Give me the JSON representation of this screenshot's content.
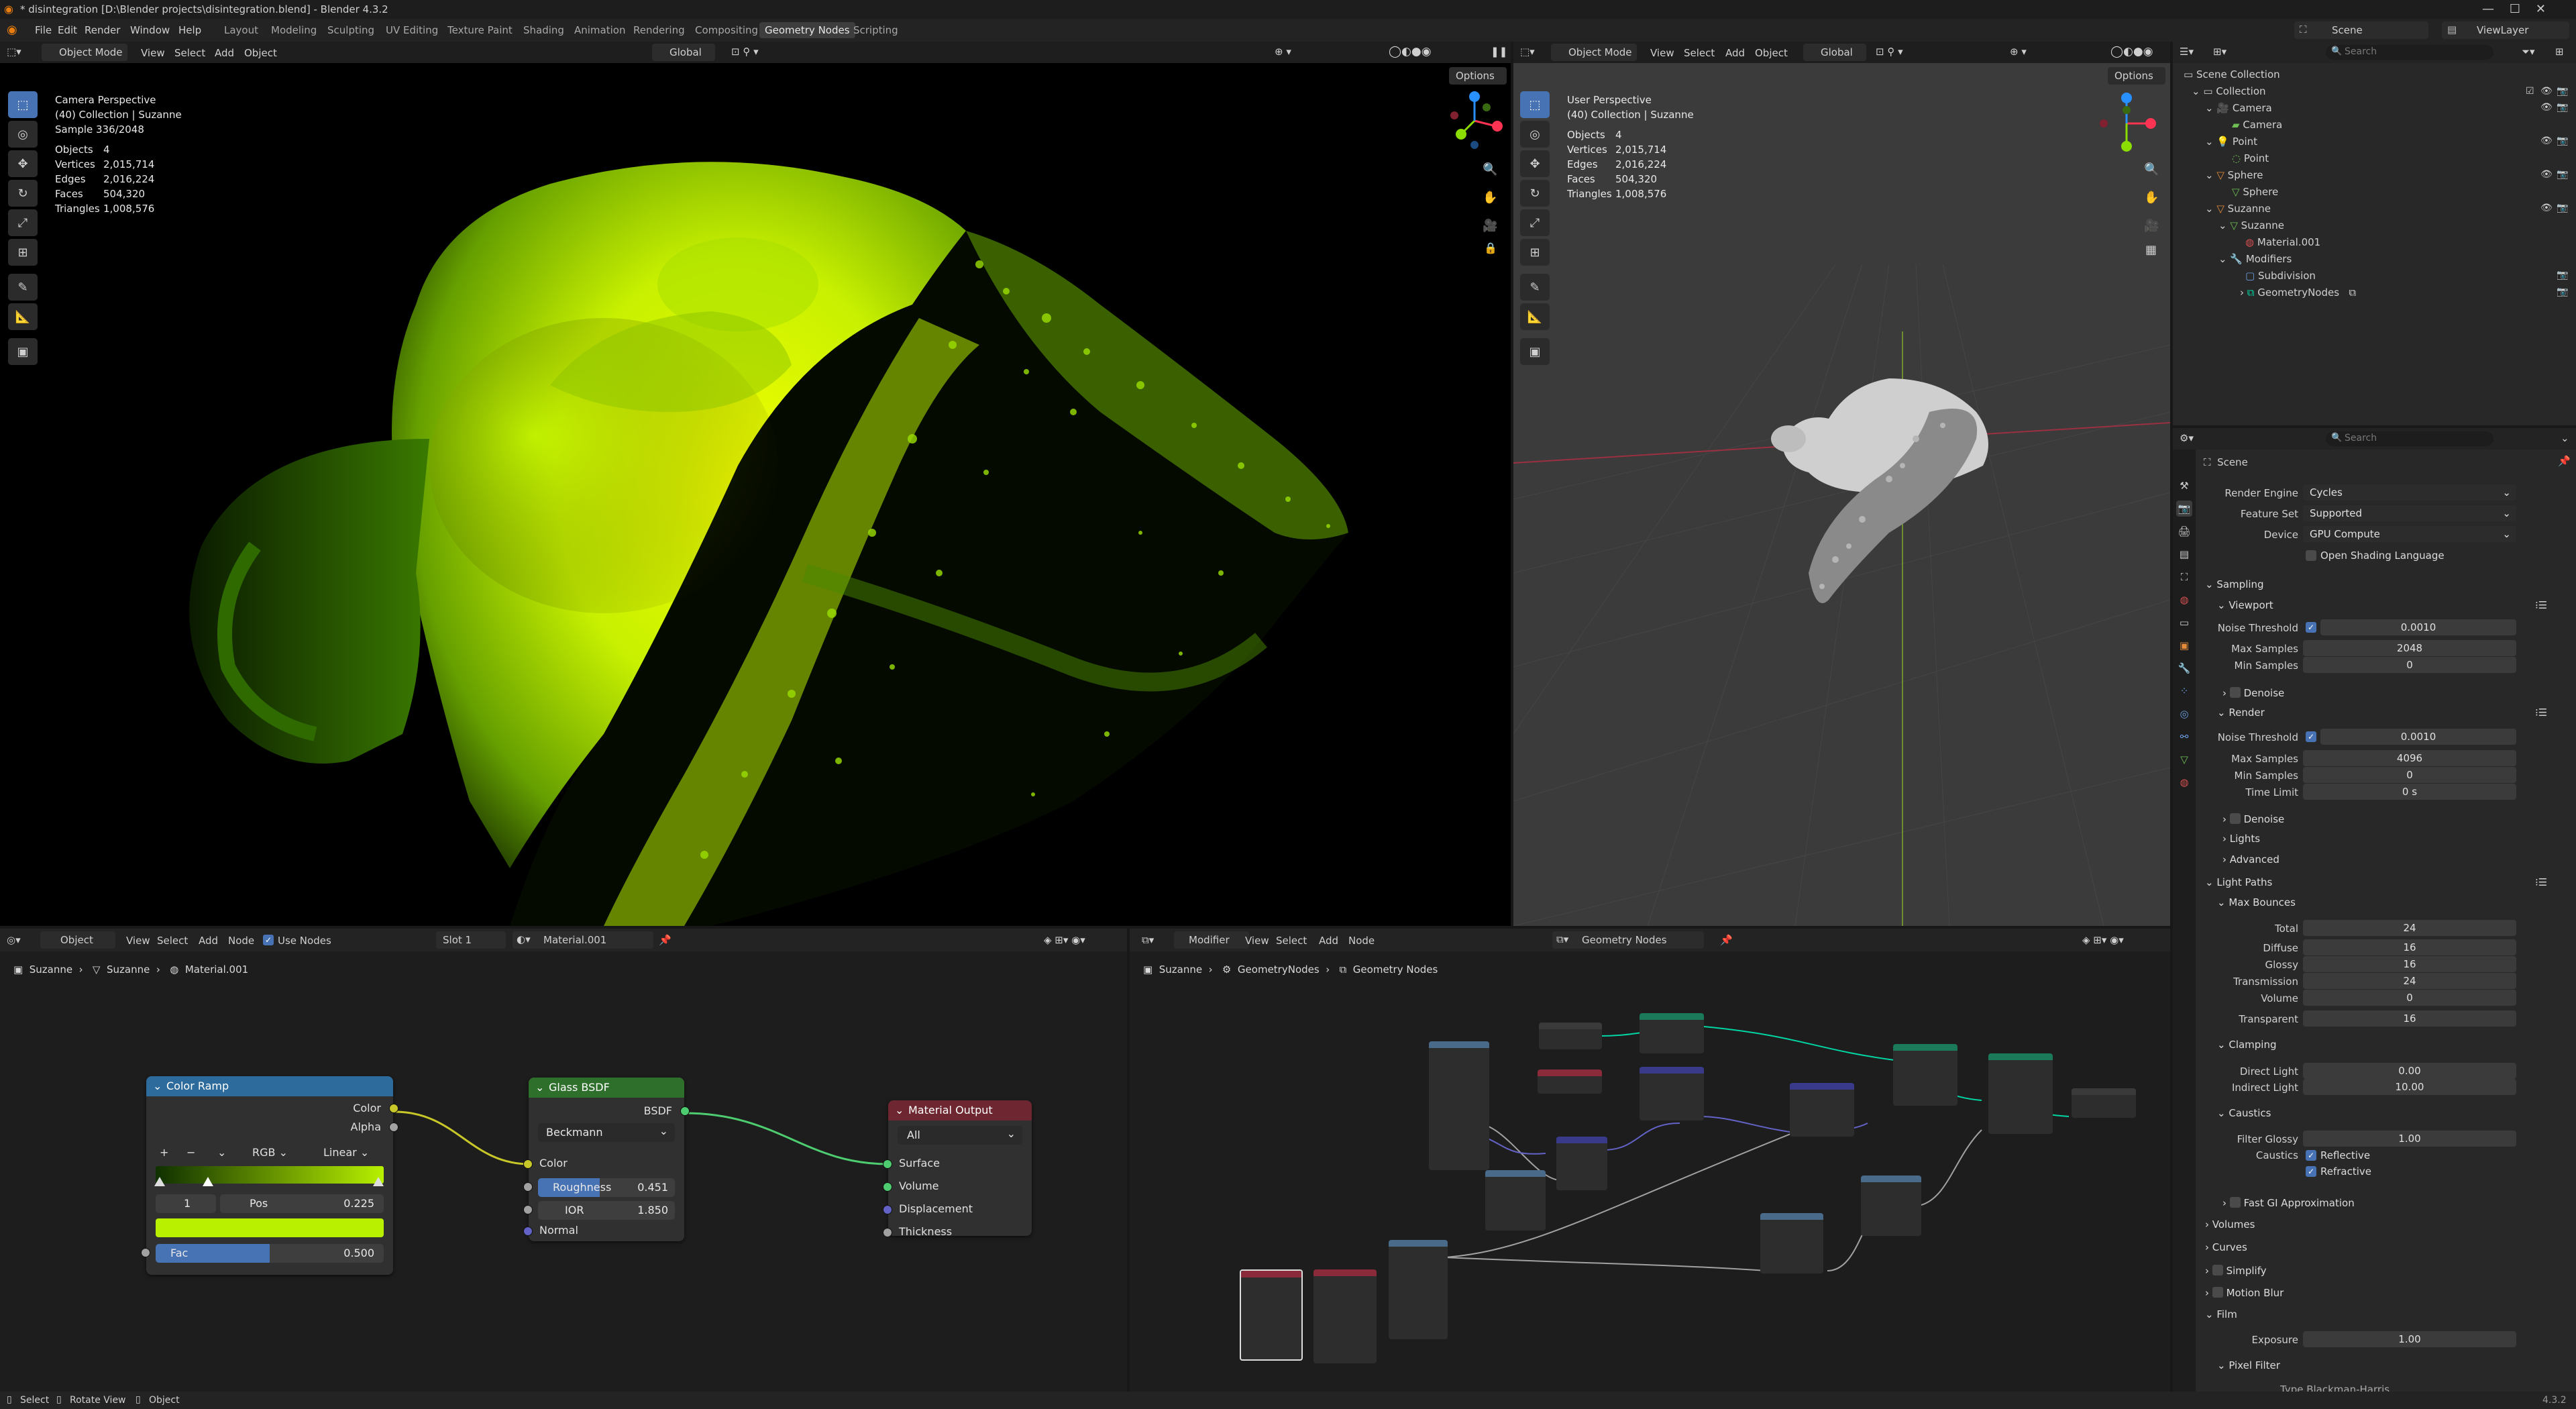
{
  "window": {
    "title": "* disintegration [D:\\Blender projects\\disintegration.blend] - Blender 4.3.2"
  },
  "menu": [
    "File",
    "Edit",
    "Render",
    "Window",
    "Help"
  ],
  "workspaces": [
    "Layout",
    "Modeling",
    "Sculpting",
    "UV Editing",
    "Texture Paint",
    "Shading",
    "Animation",
    "Rendering",
    "Compositing",
    "Geometry Nodes",
    "Scripting"
  ],
  "active_workspace": "Geometry Nodes",
  "topbar": {
    "scene": "Scene",
    "view_layer": "ViewLayer"
  },
  "vp_left": {
    "header": {
      "mode": "Object Mode",
      "view": "View",
      "select": "Select",
      "add": "Add",
      "object": "Object",
      "orientation": "Global",
      "options": "Options"
    },
    "overlay": {
      "title": "Camera Perspective",
      "collection": "(40) Collection | Suzanne",
      "sample": "Sample 336/2048",
      "stats": [
        {
          "label": "Objects",
          "value": "4"
        },
        {
          "label": "Vertices",
          "value": "2,015,714"
        },
        {
          "label": "Edges",
          "value": "2,016,224"
        },
        {
          "label": "Faces",
          "value": "504,320"
        },
        {
          "label": "Triangles",
          "value": "1,008,576"
        }
      ]
    }
  },
  "vp_right": {
    "header": {
      "mode": "Object Mode",
      "view": "View",
      "select": "Select",
      "add": "Add",
      "object": "Object",
      "orientation": "Global",
      "options": "Options"
    },
    "overlay": {
      "title": "User Perspective",
      "collection": "(40) Collection | Suzanne",
      "stats": [
        {
          "label": "Objects",
          "value": "4"
        },
        {
          "label": "Vertices",
          "value": "2,015,714"
        },
        {
          "label": "Edges",
          "value": "2,016,224"
        },
        {
          "label": "Faces",
          "value": "504,320"
        },
        {
          "label": "Triangles",
          "value": "1,008,576"
        }
      ]
    }
  },
  "shader": {
    "header": {
      "type": "Object",
      "view": "View",
      "select": "Select",
      "add": "Add",
      "node": "Node",
      "use_nodes": "Use Nodes",
      "slot": "Slot 1",
      "material": "Material.001"
    },
    "breadcrumb": [
      "Suzanne",
      "Suzanne",
      "Material.001"
    ],
    "color_ramp": {
      "title": "Color Ramp",
      "out_color": "Color",
      "out_alpha": "Alpha",
      "mode": "RGB",
      "interp": "Linear",
      "index": "1",
      "pos_label": "Pos",
      "pos_value": "0.225",
      "fac_label": "Fac",
      "fac_value": "0.500",
      "fac_fill": 0.5,
      "ramp_start": "#0f3000",
      "ramp_end": "#b8f000"
    },
    "glass": {
      "title": "Glass BSDF",
      "out": "BSDF",
      "distribution": "Beckmann",
      "color": "Color",
      "roughness_label": "Roughness",
      "roughness_value": "0.451",
      "roughness_fill": 0.451,
      "ior_label": "IOR",
      "ior_value": "1.850",
      "normal": "Normal"
    },
    "output": {
      "title": "Material Output",
      "target": "All",
      "surface": "Surface",
      "volume": "Volume",
      "displacement": "Displacement",
      "thickness": "Thickness"
    }
  },
  "geonodes": {
    "header": {
      "type": "Modifier",
      "view": "View",
      "select": "Select",
      "add": "Add",
      "node": "Node",
      "tree": "Geometry Nodes"
    },
    "breadcrumb": [
      "Suzanne",
      "GeometryNodes",
      "Geometry Nodes"
    ]
  },
  "outliner": {
    "search": "Search",
    "items": [
      {
        "label": "Scene Collection"
      },
      {
        "label": "Collection"
      },
      {
        "label": "Camera"
      },
      {
        "label": "Camera"
      },
      {
        "label": "Point"
      },
      {
        "label": "Point"
      },
      {
        "label": "Sphere"
      },
      {
        "label": "Sphere"
      },
      {
        "label": "Suzanne"
      },
      {
        "label": "Suzanne"
      },
      {
        "label": "Material.001"
      },
      {
        "label": "Modifiers"
      },
      {
        "label": "Subdivision"
      },
      {
        "label": "GeometryNodes"
      }
    ]
  },
  "properties": {
    "search": "Search",
    "context": "Scene",
    "render_engine": {
      "label": "Render Engine",
      "value": "Cycles"
    },
    "feature_set": {
      "label": "Feature Set",
      "value": "Supported"
    },
    "device": {
      "label": "Device",
      "value": "GPU Compute"
    },
    "osl": "Open Shading Language",
    "sampling": "Sampling",
    "viewport": "Viewport",
    "vp_noise": {
      "label": "Noise Threshold",
      "value": "0.0010"
    },
    "vp_max": {
      "label": "Max Samples",
      "value": "2048"
    },
    "vp_min": {
      "label": "Min Samples",
      "value": "0"
    },
    "denoise": "Denoise",
    "render": "Render",
    "r_noise": {
      "label": "Noise Threshold",
      "value": "0.0010"
    },
    "r_max": {
      "label": "Max Samples",
      "value": "4096"
    },
    "r_min": {
      "label": "Min Samples",
      "value": "0"
    },
    "r_time": {
      "label": "Time Limit",
      "value": "0 s"
    },
    "denoise2": "Denoise",
    "lights": "Lights",
    "advanced": "Advanced",
    "light_paths": "Light Paths",
    "max_bounces": "Max Bounces",
    "bounces": [
      {
        "label": "Total",
        "value": "24"
      },
      {
        "label": "Diffuse",
        "value": "16"
      },
      {
        "label": "Glossy",
        "value": "16"
      },
      {
        "label": "Transmission",
        "value": "24"
      },
      {
        "label": "Volume",
        "value": "0"
      },
      {
        "label": "Transparent",
        "value": "16"
      }
    ],
    "clamping": "Clamping",
    "direct": {
      "label": "Direct Light",
      "value": "0.00"
    },
    "indirect": {
      "label": "Indirect Light",
      "value": "10.00"
    },
    "caustics": "Caustics",
    "filter_glossy": {
      "label": "Filter Glossy",
      "value": "1.00"
    },
    "caustics_label": "Caustics",
    "reflective": "Reflective",
    "refractive": "Refractive",
    "fast_gi": "Fast GI Approximation",
    "volumes": "Volumes",
    "curves": "Curves",
    "simplify": "Simplify",
    "motion_blur": "Motion Blur",
    "film": "Film",
    "exposure": {
      "label": "Exposure",
      "value": "1.00"
    },
    "pixel_filter": "Pixel Filter",
    "type_cut": "Type    Blackman-Harris"
  },
  "status": {
    "select": "Select",
    "rotate": "Rotate View",
    "object": "Object",
    "version": "4.3.2"
  }
}
